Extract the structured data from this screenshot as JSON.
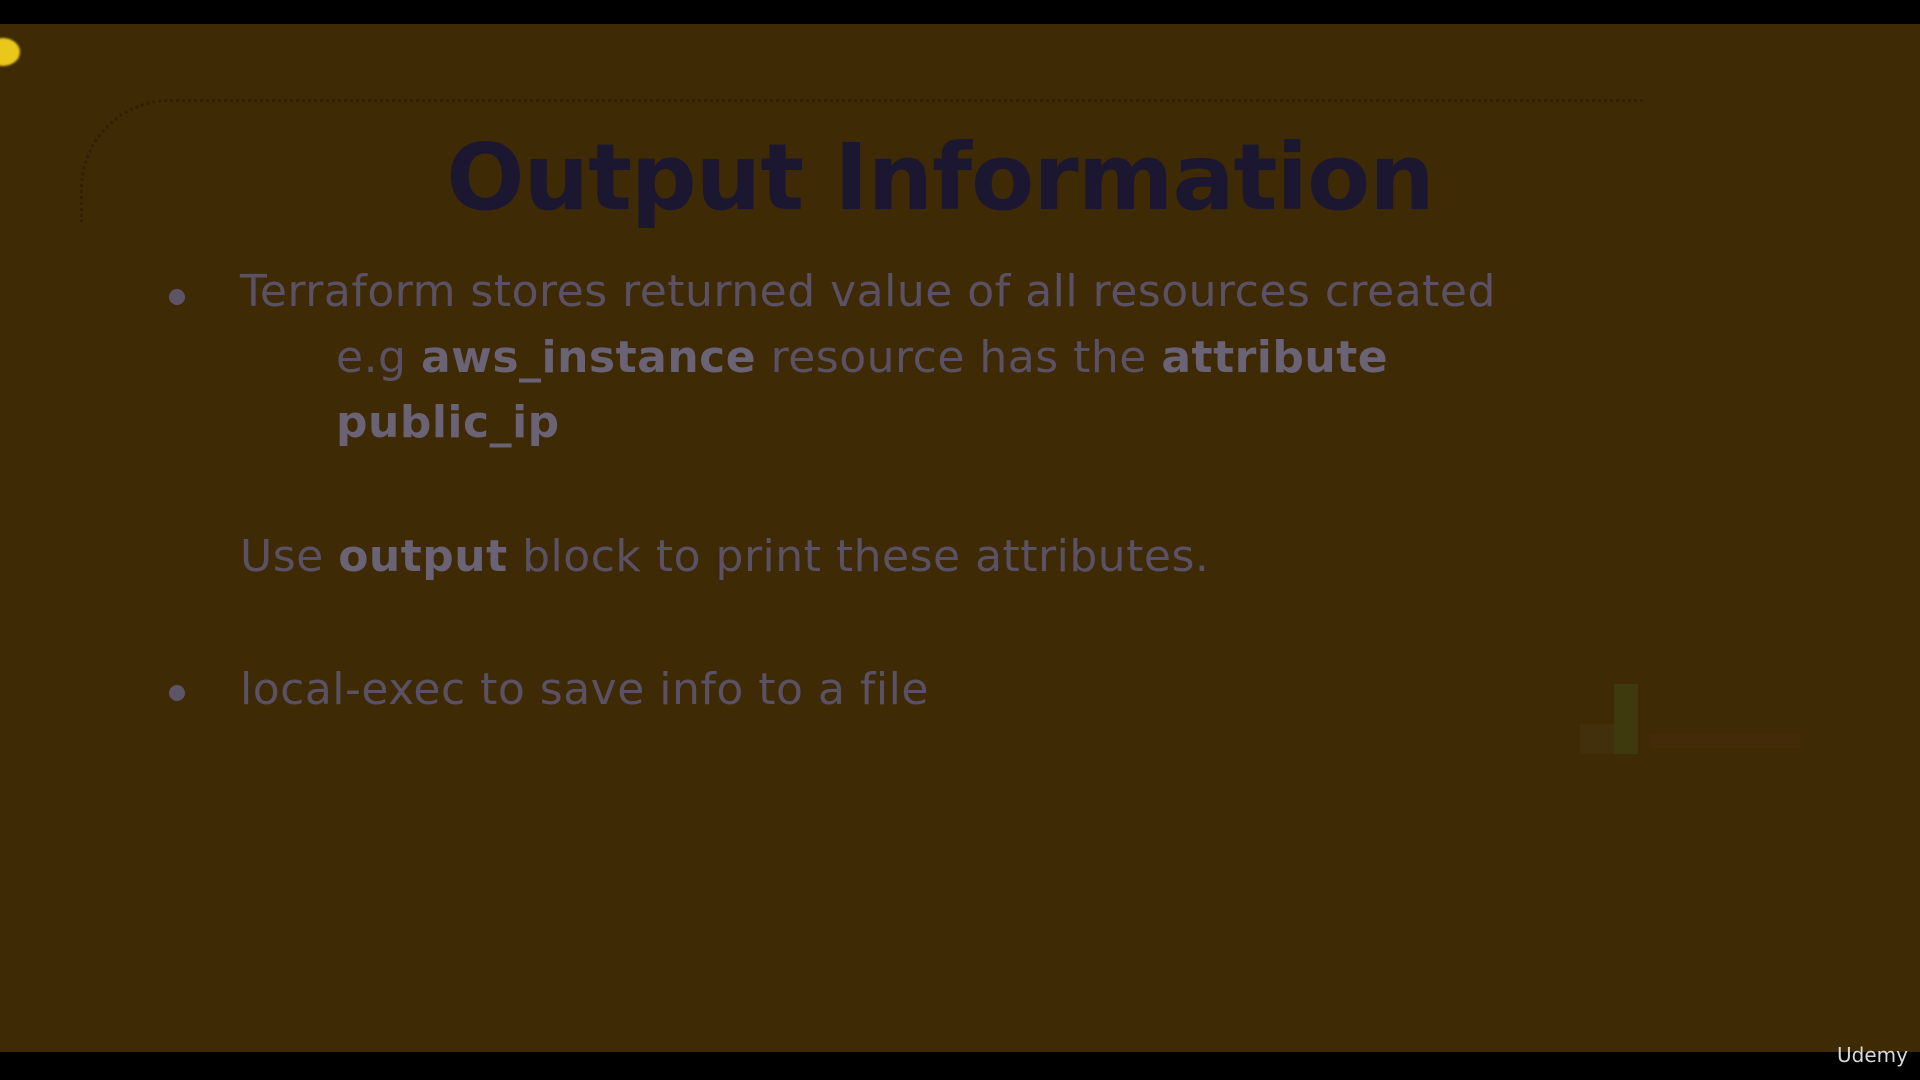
{
  "slide": {
    "title": "Output Information",
    "bullet1": {
      "line1": "Terraform stores returned value of all resources created",
      "line2_prefix": "e.g ",
      "line2_bold1": "aws_instance",
      "line2_mid": " resource has the ",
      "line2_bold2": "attribute",
      "line3_bold": "public_ip"
    },
    "sub_point": {
      "prefix": "Use ",
      "bold": "output",
      "suffix": " block to print these attributes."
    },
    "bullet2": "local-exec to save info to a file"
  },
  "watermark": "Udemy",
  "colors": {
    "background": "#3f2a06",
    "title": "#1c1730",
    "body_text": "#5a5264",
    "cursor_highlight": "#e9c81b"
  }
}
